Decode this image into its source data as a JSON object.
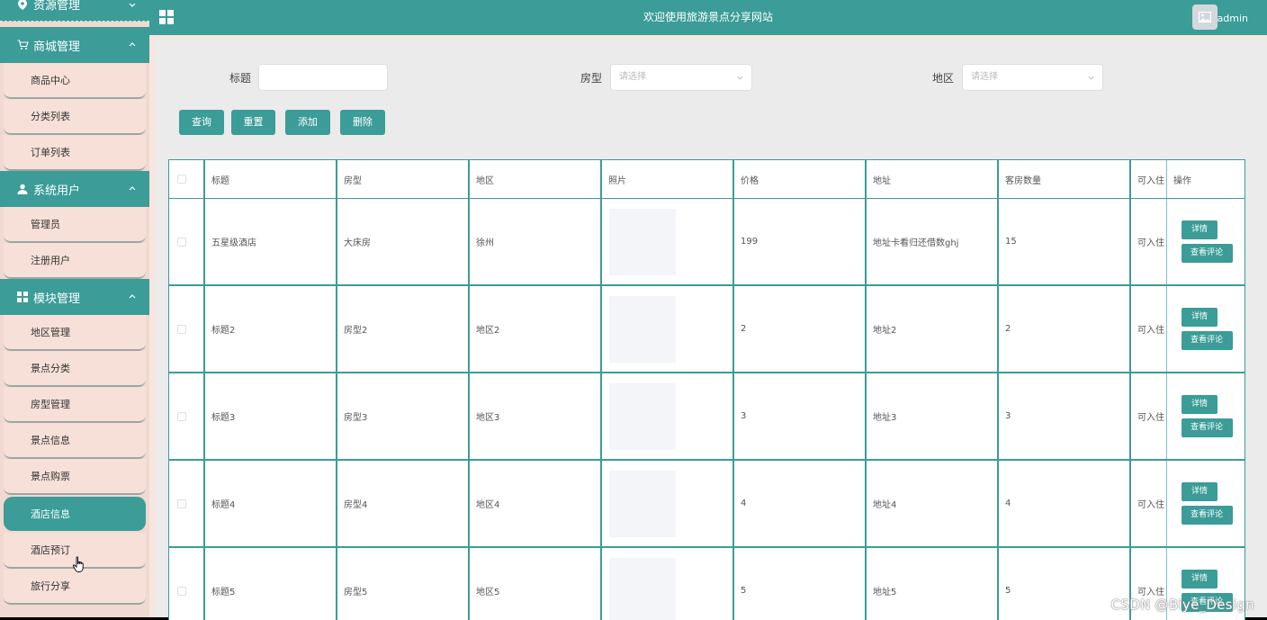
{
  "sidebar": {
    "top_group": "资源管理",
    "groups": [
      {
        "label": "商城管理",
        "icon": "cart-icon",
        "items": [
          "商品中心",
          "分类列表",
          "订单列表"
        ]
      },
      {
        "label": "系统用户",
        "icon": "user-icon",
        "items": [
          "管理员",
          "注册用户"
        ]
      },
      {
        "label": "模块管理",
        "icon": "grid-icon",
        "items": [
          "地区管理",
          "景点分类",
          "房型管理",
          "景点信息",
          "景点购票",
          "酒店信息",
          "酒店预订",
          "旅行分享"
        ]
      }
    ],
    "active_item": "酒店信息"
  },
  "header": {
    "title": "欢迎使用旅游景点分享网站",
    "username": "admin"
  },
  "filters": {
    "title_label": "标题",
    "title_value": "",
    "room_label": "房型",
    "room_placeholder": "请选择",
    "region_label": "地区",
    "region_placeholder": "请选择"
  },
  "buttons": {
    "query": "查询",
    "reset": "重置",
    "add": "添加",
    "delete": "删除"
  },
  "table": {
    "columns": [
      "标题",
      "房型",
      "地区",
      "照片",
      "价格",
      "地址",
      "客房数量",
      "可入住",
      "操作"
    ],
    "rows": [
      {
        "title": "五星级酒店",
        "room": "大床房",
        "region": "徐州",
        "price": "199",
        "address": "地址卡看归还借数ghj",
        "count": "15",
        "avail": "可入住"
      },
      {
        "title": "标题2",
        "room": "房型2",
        "region": "地区2",
        "price": "2",
        "address": "地址2",
        "count": "2",
        "avail": "可入住"
      },
      {
        "title": "标题3",
        "room": "房型3",
        "region": "地区3",
        "price": "3",
        "address": "地址3",
        "count": "3",
        "avail": "可入住"
      },
      {
        "title": "标题4",
        "room": "房型4",
        "region": "地区4",
        "price": "4",
        "address": "地址4",
        "count": "4",
        "avail": "可入住"
      },
      {
        "title": "标题5",
        "room": "房型5",
        "region": "地区5",
        "price": "5",
        "address": "地址5",
        "count": "5",
        "avail": "可入住"
      }
    ],
    "detail_label": "详情",
    "comment_label": "查看评论"
  },
  "watermark": "CSDN @Biye_Design",
  "colors": {
    "accent": "#3b9c98",
    "sidebar_bg": "#f0d9d1",
    "panel_bg": "#ebebeb"
  }
}
